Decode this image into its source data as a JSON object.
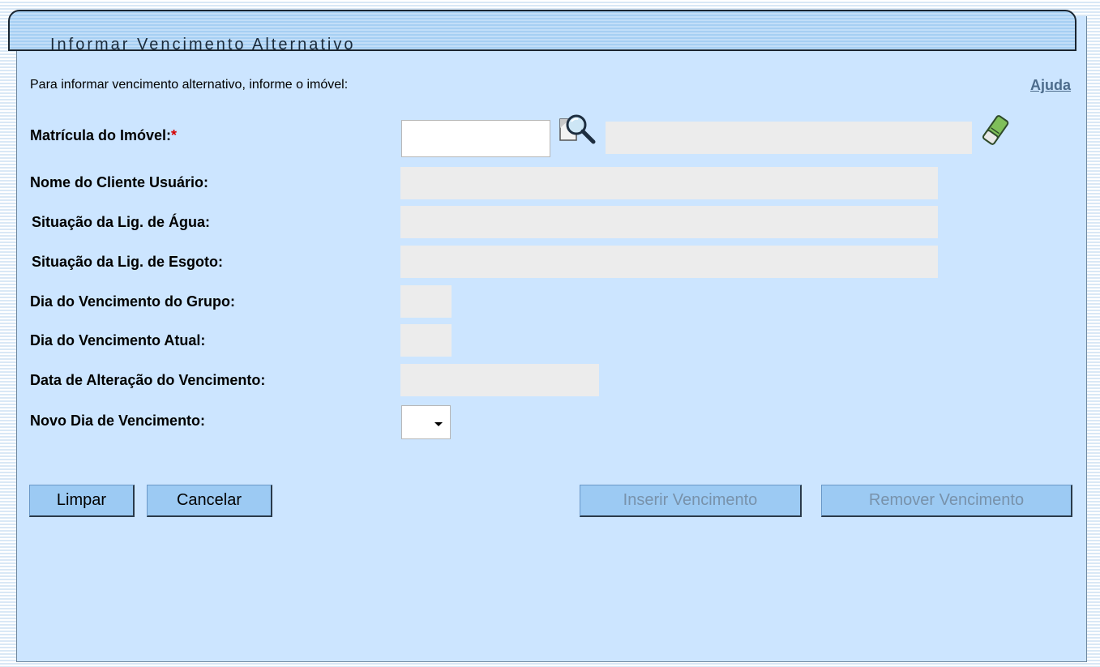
{
  "form": {
    "title": "Informar Vencimento Alternativo",
    "intro": "Para informar vencimento alternativo, informe o imóvel:",
    "help_link": "Ajuda",
    "required_marker": "*"
  },
  "fields": {
    "matricula": {
      "label": "Matrícula do Imóvel:",
      "value": "",
      "description": ""
    },
    "nome_cliente": {
      "label": "Nome do Cliente Usuário:",
      "value": ""
    },
    "situacao_agua": {
      "label": "Situação da Lig. de Água:",
      "value": ""
    },
    "situacao_esgoto": {
      "label": "Situação da Lig. de Esgoto:",
      "value": ""
    },
    "dia_venc_grupo": {
      "label": "Dia do Vencimento do Grupo:",
      "value": ""
    },
    "dia_venc_atual": {
      "label": "Dia do Vencimento Atual:",
      "value": ""
    },
    "data_alteracao": {
      "label": "Data de Alteração do Vencimento:",
      "value": ""
    },
    "novo_dia": {
      "label": "Novo Dia de Vencimento:",
      "selected": ""
    }
  },
  "icons": {
    "search": "magnifier-search-icon",
    "clear": "eraser-clear-icon"
  },
  "buttons": {
    "limpar": "Limpar",
    "cancelar": "Cancelar",
    "inserir": "Inserir Vencimento",
    "remover": "Remover Vencimento"
  },
  "colors": {
    "panel_bg": "#cce5ff",
    "button_bg": "#9ccaf3",
    "disabled_text": "#7892ab",
    "required": "#d40000",
    "readonly_field": "#ececec"
  }
}
